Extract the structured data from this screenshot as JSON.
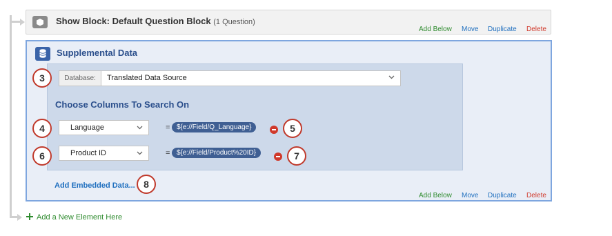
{
  "show_block": {
    "title": "Show Block: Default Question Block",
    "count": "(1 Question)",
    "actions": {
      "add_below": "Add Below",
      "move": "Move",
      "duplicate": "Duplicate",
      "delete": "Delete"
    }
  },
  "supplemental": {
    "title": "Supplemental Data",
    "database": {
      "label": "Database:",
      "value": "Translated Data Source"
    },
    "section_title": "Choose Columns To Search On",
    "columns": [
      {
        "column": "Language",
        "equals": "=",
        "value": "${e://Field/Q_Language}"
      },
      {
        "column": "Product ID",
        "equals": "=",
        "value": "${e://Field/Product%20ID}"
      }
    ],
    "add_embedded": "Add Embedded Data...",
    "actions": {
      "add_below": "Add Below",
      "move": "Move",
      "duplicate": "Duplicate",
      "delete": "Delete"
    }
  },
  "callouts": [
    "3",
    "4",
    "5",
    "6",
    "7",
    "8"
  ],
  "add_new_element": "Add a New Element Here",
  "colors": {
    "add": "#2e8b2e",
    "link": "#1f6fbf",
    "delete": "#d0392b",
    "block_border": "#7ea6df",
    "callout": "#c0392b"
  }
}
